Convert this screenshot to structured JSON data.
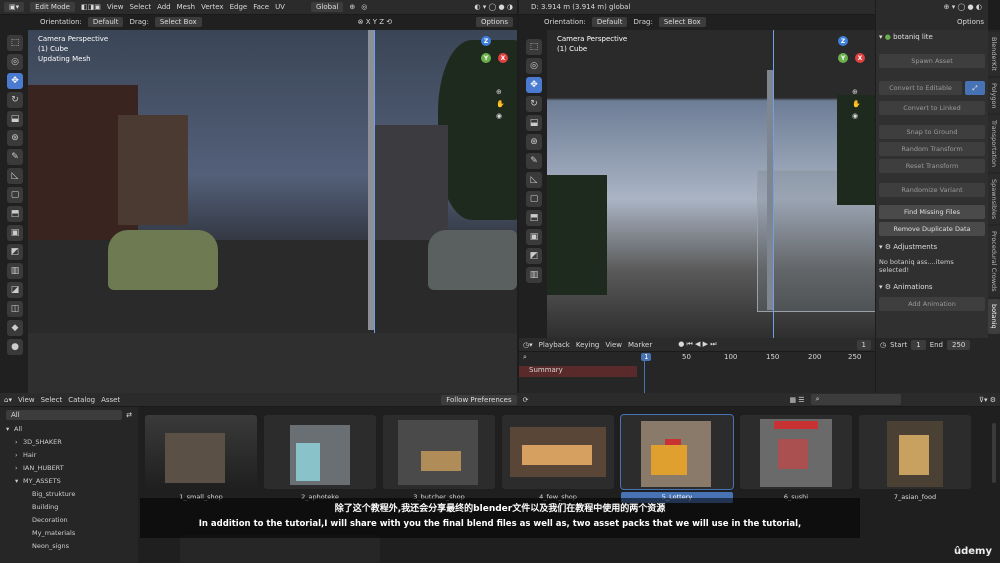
{
  "left_viewport": {
    "header": {
      "mode": "Edit Mode",
      "menus": [
        "View",
        "Select",
        "Add",
        "Mesh",
        "Vertex",
        "Edge",
        "Face",
        "UV"
      ],
      "transform": "Global"
    },
    "subheader": {
      "orientation_label": "Orientation:",
      "orientation_value": "Default",
      "drag_label": "Drag:",
      "drag_value": "Select Box",
      "options": "Options"
    },
    "overlay": {
      "line1": "Camera Perspective",
      "line2": "(1) Cube",
      "line3": "Updating Mesh"
    }
  },
  "right_viewport": {
    "header": {
      "measure": "D: 3.914 m (3.914 m) global"
    },
    "subheader": {
      "orientation_label": "Orientation:",
      "orientation_value": "Default",
      "drag_label": "Drag:",
      "drag_value": "Select Box",
      "options": "Options"
    },
    "overlay": {
      "line1": "Camera Perspective",
      "line2": "(1) Cube"
    }
  },
  "gizmo": {
    "z": "Z",
    "y": "Y",
    "x": "X"
  },
  "botaniq": {
    "title": "botaniq lite",
    "buttons": [
      "Spawn Asset",
      "Convert to Editable",
      "Convert to Linked",
      "Snap to Ground",
      "Random Transform",
      "Reset Transform",
      "Randomize Variant"
    ],
    "find_missing": "Find Missing Files",
    "remove_duplicate": "Remove Duplicate Data",
    "adjustments": "Adjustments",
    "adjust_msg": "No botaniq ass....items selected!",
    "animations": "Animations",
    "add_animation": "Add Animation"
  },
  "side_tabs": [
    "BlenderKit",
    "Polygon",
    "Transportation",
    "Spawnsibles",
    "Procedural Crowds",
    "botaniq"
  ],
  "timeline": {
    "menus": [
      "Playback",
      "Keying",
      "View",
      "Marker"
    ],
    "frame": "1",
    "start_label": "Start",
    "start": "1",
    "end_label": "End",
    "end": "250",
    "ruler": [
      "1",
      "50",
      "100",
      "150",
      "200",
      "250"
    ],
    "summary": "Summary"
  },
  "asset_browser": {
    "header": {
      "menus": [
        "View",
        "Select",
        "Catalog",
        "Asset"
      ],
      "preferences": "Follow Preferences",
      "filter": "All"
    },
    "tree": [
      {
        "label": "All",
        "indent": 0,
        "arrow": "▾"
      },
      {
        "label": "3D_SHAKER",
        "indent": 1,
        "arrow": "›"
      },
      {
        "label": "Hair",
        "indent": 1,
        "arrow": "›"
      },
      {
        "label": "IAN_HUBERT",
        "indent": 1,
        "arrow": "›"
      },
      {
        "label": "MY_ASSETS",
        "indent": 1,
        "arrow": "▾"
      },
      {
        "label": "Big_strukture",
        "indent": 2,
        "arrow": ""
      },
      {
        "label": "Building",
        "indent": 2,
        "arrow": ""
      },
      {
        "label": "Decoration",
        "indent": 2,
        "arrow": ""
      },
      {
        "label": "My_materials",
        "indent": 2,
        "arrow": ""
      },
      {
        "label": "Neon_signs",
        "indent": 2,
        "arrow": ""
      }
    ],
    "assets": [
      "1_small_shop",
      "2_aphoteke",
      "3_butcher_shop",
      "4_few_shop",
      "5_Lottery",
      "6_sushi",
      "7_asian_food"
    ],
    "selected_index": 4
  },
  "subtitles": {
    "zh": "除了这个教程外,我还会分享最终的blender文件以及我们在教程中使用的两个资源",
    "en": "In addition to the tutorial,I will share with you the final blend files as well as, two asset packs that we will use in the tutorial,"
  },
  "watermark": "ûdemy",
  "colors": {
    "accent": "#4772b3",
    "x_axis": "#e04040",
    "y_axis": "#6ab04c",
    "z_axis": "#3f7fdc"
  }
}
